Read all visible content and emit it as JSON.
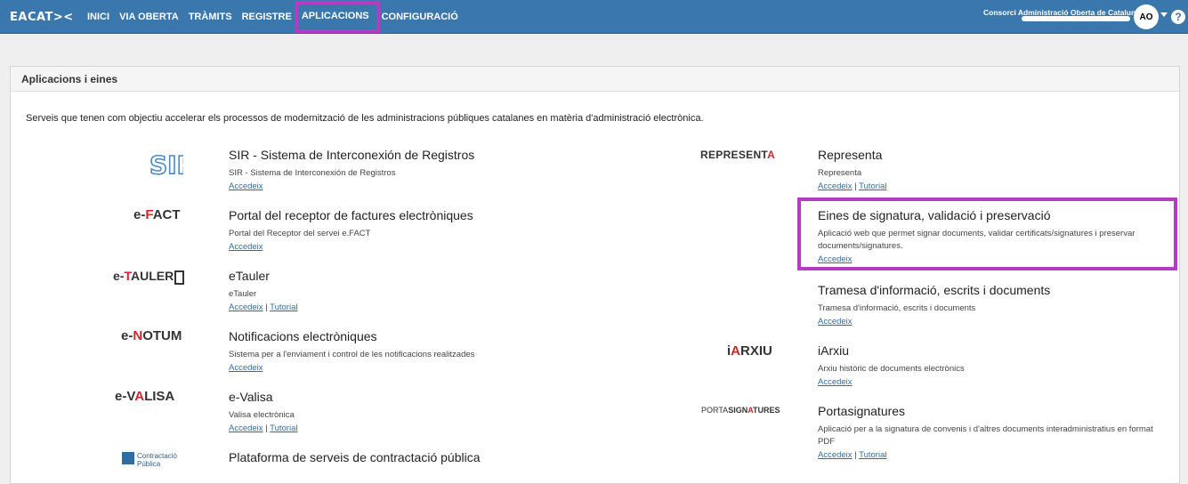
{
  "topbar": {
    "logo": "EACAT><",
    "nav": [
      "INICI",
      "VIA OBERTA",
      "TRÀMITS",
      "REGISTRE",
      "APLICACIONS",
      "CONFIGURACIÓ"
    ],
    "active_nav": "APLICACIONS",
    "org": "Consorci Administració Oberta de Catalunya",
    "avatar": "AO",
    "help": "?",
    "accent": "#3a77ad",
    "highlight_color": "#b33cc2"
  },
  "panel": {
    "title": "Aplicacions i eines",
    "intro": "Serveis que tenen com objectiu accelerar els processos de modernització de les administracions públiques catalanes en matèria d'administració electrònica."
  },
  "apps_left": [
    {
      "logo": "SIR",
      "title": "SIR - Sistema de Interconexión de Registros",
      "desc": "SIR - Sistema de Interconexión de Registros",
      "links": [
        "Accedeix"
      ]
    },
    {
      "logo": "e-FACT",
      "title": "Portal del receptor de factures electròniques",
      "desc": "Portal del Receptor del servei e.FACT",
      "links": [
        "Accedeix"
      ]
    },
    {
      "logo": "e-TAULER",
      "title": "eTauler",
      "desc": "eTauler",
      "links": [
        "Accedeix",
        "Tutorial"
      ]
    },
    {
      "logo": "e-NOTUM",
      "title": "Notificacions electròniques",
      "desc": "Sistema per a l'enviament i control de les notificacions realitzades",
      "links": [
        "Accedeix"
      ]
    },
    {
      "logo": "e-VALISA",
      "title": "e-Valisa",
      "desc": "Valisa electrònica",
      "links": [
        "Accedeix",
        "Tutorial"
      ]
    },
    {
      "logo": "Contractació Pública",
      "title": "Plataforma de serveis de contractació pública",
      "desc": "",
      "links": []
    }
  ],
  "apps_right": [
    {
      "logo": "REPRESENTA",
      "title": "Representa",
      "desc": "Representa",
      "links": [
        "Accedeix",
        "Tutorial"
      ]
    },
    {
      "logo": "",
      "title": "Eines de signatura, validació i preservació",
      "desc": "Aplicació web que permet signar documents, validar certificats/signatures i preservar documents/signatures.",
      "links": [
        "Accedeix"
      ]
    },
    {
      "logo": "",
      "title": "Tramesa d'informació, escrits i documents",
      "desc": "Tramesa d'informació, escrits i documents",
      "links": [
        "Accedeix"
      ]
    },
    {
      "logo": "iARXIU",
      "title": "iArxiu",
      "desc": "Arxiu històric de documents electrònics",
      "links": [
        "Accedeix"
      ]
    },
    {
      "logo": "PORTASIGNATURES",
      "title": "Portasignatures",
      "desc": "Aplicació per a la signatura de convenis i d'altres documents interadministratius en format PDF",
      "links": [
        "Accedeix",
        "Tutorial"
      ]
    }
  ]
}
